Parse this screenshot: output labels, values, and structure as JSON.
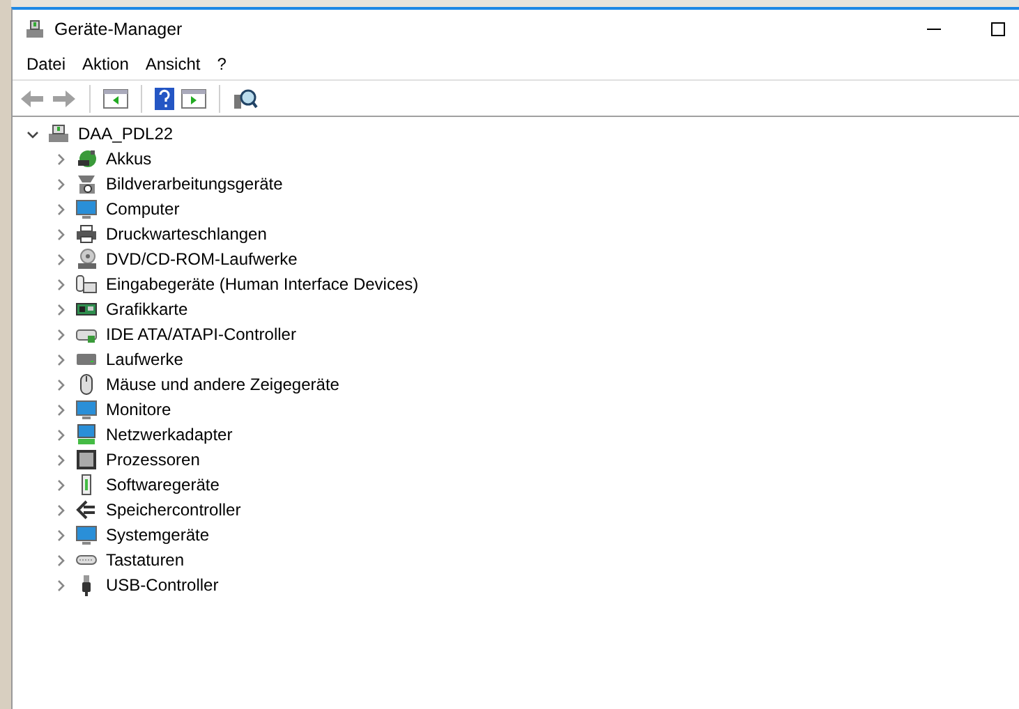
{
  "window": {
    "title": "Geräte-Manager"
  },
  "menu": [
    "Datei",
    "Aktion",
    "Ansicht",
    "?"
  ],
  "toolbar": [
    {
      "kind": "back",
      "disabled": true
    },
    {
      "kind": "forward",
      "disabled": true
    },
    {
      "kind": "sep"
    },
    {
      "kind": "panel"
    },
    {
      "kind": "sep"
    },
    {
      "kind": "help"
    },
    {
      "kind": "panel2"
    },
    {
      "kind": "sep"
    },
    {
      "kind": "scan"
    }
  ],
  "tree": {
    "label": "DAA_PDL22",
    "expanded": true,
    "children": [
      {
        "label": "Akkus",
        "kind": "battery",
        "expanded": false
      },
      {
        "label": "Bildverarbeitungsgeräte",
        "kind": "camera",
        "expanded": false
      },
      {
        "label": "Computer",
        "kind": "monitor",
        "expanded": false
      },
      {
        "label": "Druckwarteschlangen",
        "kind": "printer",
        "expanded": false
      },
      {
        "label": "DVD/CD-ROM-Laufwerke",
        "kind": "disc",
        "expanded": false
      },
      {
        "label": "Eingabegeräte (Human Interface Devices)",
        "kind": "input",
        "expanded": false
      },
      {
        "label": "Grafikkarte",
        "kind": "card",
        "expanded": false
      },
      {
        "label": "IDE ATA/ATAPI-Controller",
        "kind": "ide",
        "expanded": false
      },
      {
        "label": "Laufwerke",
        "kind": "drive",
        "expanded": false
      },
      {
        "label": "Mäuse und andere Zeigegeräte",
        "kind": "mouse",
        "expanded": false
      },
      {
        "label": "Monitore",
        "kind": "monitor",
        "expanded": false
      },
      {
        "label": "Netzwerkadapter",
        "kind": "network",
        "expanded": false
      },
      {
        "label": "Prozessoren",
        "kind": "cpu",
        "expanded": false
      },
      {
        "label": "Softwaregeräte",
        "kind": "software",
        "expanded": false
      },
      {
        "label": "Speichercontroller",
        "kind": "storage",
        "expanded": false
      },
      {
        "label": "Systemgeräte",
        "kind": "monitor",
        "expanded": false
      },
      {
        "label": "Tastaturen",
        "kind": "keyboard",
        "expanded": false
      },
      {
        "label": "USB-Controller",
        "kind": "usb",
        "expanded": false
      }
    ]
  }
}
